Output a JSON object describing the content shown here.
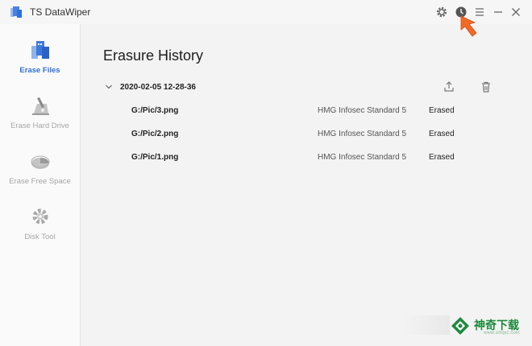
{
  "app": {
    "title": "TS DataWiper",
    "brand_color": "#2f6fd6"
  },
  "titlebar": {
    "icons": [
      "gear-icon",
      "history-icon",
      "menu-icon",
      "minimize-icon",
      "close-icon"
    ]
  },
  "sidebar": {
    "items": [
      {
        "label": "Erase Files",
        "icon": "erase-files-icon",
        "active": true
      },
      {
        "label": "Erase Hard Drive",
        "icon": "erase-hard-drive-icon",
        "active": false
      },
      {
        "label": "Erase Free Space",
        "icon": "erase-free-space-icon",
        "active": false
      },
      {
        "label": "Disk Tool",
        "icon": "disk-tool-icon",
        "active": false
      }
    ]
  },
  "main": {
    "heading": "Erasure History",
    "session": {
      "date": "2020-02-05 12-28-36",
      "actions": [
        "export-icon",
        "trash-icon"
      ],
      "files": [
        {
          "name": "G:/Pic/3.png",
          "standard": "HMG Infosec Standard 5",
          "status": "Erased"
        },
        {
          "name": "G:/Pic/2.png",
          "standard": "HMG Infosec Standard 5",
          "status": "Erased"
        },
        {
          "name": "G:/Pic/1.png",
          "standard": "HMG Infosec Standard 5",
          "status": "Erased"
        }
      ]
    }
  },
  "watermark": {
    "text": "神奇下载",
    "subtext": "www.smqxz.com",
    "color": "#1f8a3d"
  }
}
